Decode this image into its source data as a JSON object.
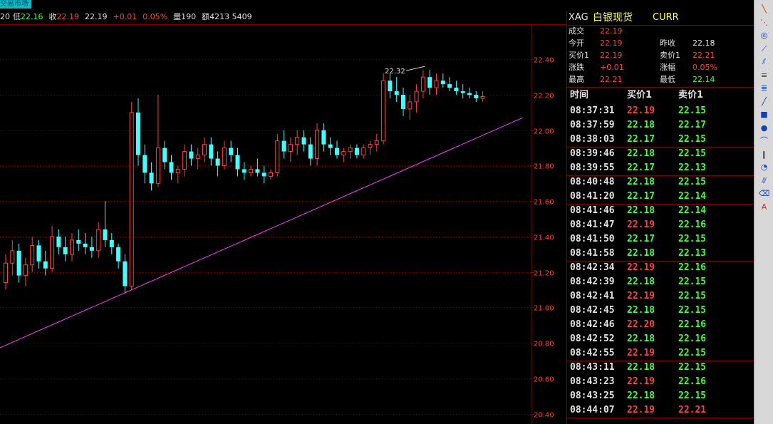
{
  "window": {
    "market_tab": "交易市场"
  },
  "infobar": {
    "items": [
      {
        "label": "20",
        "value": "",
        "color": "white"
      },
      {
        "label": "低",
        "value": "22.16",
        "color": "green"
      },
      {
        "label": "收",
        "value": "22.19",
        "color": "red"
      },
      {
        "label": "",
        "value": "22.19",
        "color": "white"
      },
      {
        "label": "",
        "value": "+0.01",
        "color": "red"
      },
      {
        "label": "",
        "value": "0.05%",
        "color": "red"
      },
      {
        "label": "量",
        "value": "190",
        "color": "white"
      },
      {
        "label": "额",
        "value": "4213 5409",
        "color": "white"
      }
    ]
  },
  "quote": {
    "code": "XAG",
    "name": "白银现货",
    "curr": "CURR",
    "stats": {
      "成交": {
        "label": "成交",
        "value": "22.19"
      },
      "今开": {
        "label": "今开",
        "value": "22.19"
      },
      "昨收": {
        "label": "昨收",
        "value": "22.18"
      },
      "买价1": {
        "label": "买价1",
        "value": "22.19"
      },
      "卖价1": {
        "label": "卖价1",
        "value": "22.21"
      },
      "涨跌": {
        "label": "涨跌",
        "value": "+0.01"
      },
      "涨幅": {
        "label": "涨幅",
        "value": "0.05%"
      },
      "最高": {
        "label": "最高",
        "value": "22.21"
      },
      "最低": {
        "label": "最低",
        "value": "22.14"
      }
    },
    "ticks_header": {
      "time": "时间",
      "bid": "买价1",
      "ask": "卖价1"
    },
    "ticks": [
      {
        "time": "08:37:31",
        "bid": "22.19",
        "ask": "22.15",
        "bid_color": "red"
      },
      {
        "time": "08:37:59",
        "bid": "22.18",
        "ask": "22.17",
        "bid_color": "green"
      },
      {
        "time": "08:38:03",
        "bid": "22.17",
        "ask": "22.15",
        "bid_color": "green"
      },
      {
        "time": "08:39:46",
        "bid": "22.18",
        "ask": "22.15",
        "bid_color": "green"
      },
      {
        "time": "08:39:55",
        "bid": "22.17",
        "ask": "22.13",
        "bid_color": "green"
      },
      {
        "time": "08:40:48",
        "bid": "22.18",
        "ask": "22.15",
        "bid_color": "green"
      },
      {
        "time": "08:41:20",
        "bid": "22.17",
        "ask": "22.14",
        "bid_color": "green"
      },
      {
        "time": "08:41:46",
        "bid": "22.18",
        "ask": "22.14",
        "bid_color": "green"
      },
      {
        "time": "08:41:47",
        "bid": "22.19",
        "ask": "22.16",
        "bid_color": "red"
      },
      {
        "time": "08:41:50",
        "bid": "22.17",
        "ask": "22.15",
        "bid_color": "green"
      },
      {
        "time": "08:41:58",
        "bid": "22.18",
        "ask": "22.13",
        "bid_color": "green"
      },
      {
        "time": "08:42:34",
        "bid": "22.19",
        "ask": "22.16",
        "bid_color": "red"
      },
      {
        "time": "08:42:39",
        "bid": "22.18",
        "ask": "22.15",
        "bid_color": "green"
      },
      {
        "time": "08:42:41",
        "bid": "22.19",
        "ask": "22.15",
        "bid_color": "red"
      },
      {
        "time": "08:42:45",
        "bid": "22.18",
        "ask": "22.15",
        "bid_color": "green"
      },
      {
        "time": "08:42:46",
        "bid": "22.20",
        "ask": "22.16",
        "bid_color": "red"
      },
      {
        "time": "08:42:52",
        "bid": "22.18",
        "ask": "22.16",
        "bid_color": "green"
      },
      {
        "time": "08:42:55",
        "bid": "22.19",
        "ask": "22.15",
        "bid_color": "red"
      },
      {
        "time": "08:43:11",
        "bid": "22.18",
        "ask": "22.15",
        "bid_color": "green"
      },
      {
        "time": "08:43:23",
        "bid": "22.19",
        "ask": "22.16",
        "bid_color": "red"
      },
      {
        "time": "08:43:25",
        "bid": "22.18",
        "ask": "22.15",
        "bid_color": "green"
      },
      {
        "time": "08:44:07",
        "bid": "22.19",
        "ask": "22.21",
        "bid_color": "red"
      }
    ]
  },
  "toolbar": {
    "tools": [
      {
        "name": "line-tool-icon",
        "glyph": "╲"
      },
      {
        "name": "ray-tool-icon",
        "glyph": "⋱"
      },
      {
        "name": "arc-tool-icon",
        "glyph": "◎"
      },
      {
        "name": "fan-tool-icon",
        "glyph": "⟋"
      },
      {
        "name": "channel-tool-icon",
        "glyph": "⫽"
      },
      {
        "name": "fib-tool-icon",
        "glyph": "≡"
      },
      {
        "name": "level-tool-icon",
        "glyph": "≣"
      },
      {
        "name": "trend-tool-icon",
        "glyph": "╱"
      },
      {
        "name": "rectangle-tool-icon",
        "glyph": "■"
      },
      {
        "name": "ellipse-tool-icon",
        "glyph": "●"
      },
      {
        "name": "cycle-tool-icon",
        "glyph": "⌒"
      },
      {
        "name": "vertical-lines-tool-icon",
        "glyph": "‖"
      },
      {
        "name": "spiral-tool-icon",
        "glyph": "◔"
      },
      {
        "name": "parallel-tool-icon",
        "glyph": "⫻"
      },
      {
        "name": "eraser-tool-icon",
        "glyph": "⌫"
      },
      {
        "name": "text-tool-icon",
        "glyph": "A"
      }
    ]
  },
  "chart_data": {
    "type": "candlestick",
    "y_ticks": [
      "22.40",
      "22.20",
      "22.00",
      "21.80",
      "21.60",
      "21.40",
      "21.20",
      "21.00",
      "20.80",
      "20.60",
      "20.40"
    ],
    "ylim": [
      20.35,
      22.55
    ],
    "annotation": {
      "text": "22.32",
      "value": 22.32,
      "index": 57
    },
    "trendline": {
      "start": {
        "index": -1,
        "value": 20.77
      },
      "end": {
        "index": 78,
        "value": 22.07
      }
    },
    "candles": [
      [
        21.14,
        21.3,
        21.1,
        21.25
      ],
      [
        21.25,
        21.38,
        21.18,
        21.32
      ],
      [
        21.32,
        21.36,
        21.14,
        21.18
      ],
      [
        21.18,
        21.28,
        21.12,
        21.24
      ],
      [
        21.24,
        21.4,
        21.2,
        21.35
      ],
      [
        21.35,
        21.38,
        21.22,
        21.26
      ],
      [
        21.26,
        21.32,
        21.18,
        21.22
      ],
      [
        21.22,
        21.46,
        21.2,
        21.4
      ],
      [
        21.4,
        21.44,
        21.3,
        21.34
      ],
      [
        21.34,
        21.4,
        21.26,
        21.3
      ],
      [
        21.3,
        21.42,
        21.26,
        21.38
      ],
      [
        21.38,
        21.44,
        21.32,
        21.36
      ],
      [
        21.36,
        21.42,
        21.3,
        21.34
      ],
      [
        21.34,
        21.4,
        21.28,
        21.32
      ],
      [
        21.32,
        21.48,
        21.28,
        21.44
      ],
      [
        21.44,
        21.6,
        21.34,
        21.38
      ],
      [
        21.38,
        21.42,
        21.3,
        21.34
      ],
      [
        21.34,
        21.36,
        21.22,
        21.26
      ],
      [
        21.26,
        21.3,
        21.08,
        21.12
      ],
      [
        21.12,
        22.16,
        21.1,
        22.1
      ],
      [
        22.1,
        22.18,
        21.8,
        21.86
      ],
      [
        21.86,
        21.92,
        21.7,
        21.76
      ],
      [
        21.76,
        21.82,
        21.66,
        21.7
      ],
      [
        21.7,
        22.2,
        21.68,
        21.9
      ],
      [
        21.9,
        21.94,
        21.78,
        21.82
      ],
      [
        21.82,
        21.86,
        21.72,
        21.76
      ],
      [
        21.76,
        21.8,
        21.7,
        21.78
      ],
      [
        21.78,
        21.92,
        21.74,
        21.88
      ],
      [
        21.88,
        21.92,
        21.8,
        21.84
      ],
      [
        21.84,
        21.9,
        21.78,
        21.86
      ],
      [
        21.86,
        21.96,
        21.82,
        21.92
      ],
      [
        21.92,
        21.96,
        21.8,
        21.84
      ],
      [
        21.84,
        21.88,
        21.74,
        21.8
      ],
      [
        21.8,
        21.94,
        21.78,
        21.9
      ],
      [
        21.9,
        21.94,
        21.82,
        21.86
      ],
      [
        21.86,
        21.9,
        21.74,
        21.78
      ],
      [
        21.78,
        21.82,
        21.72,
        21.76
      ],
      [
        21.76,
        21.8,
        21.74,
        21.78
      ],
      [
        21.78,
        21.84,
        21.74,
        21.76
      ],
      [
        21.76,
        21.8,
        21.7,
        21.74
      ],
      [
        21.74,
        21.78,
        21.72,
        21.76
      ],
      [
        21.76,
        21.98,
        21.74,
        21.94
      ],
      [
        21.94,
        22.0,
        21.84,
        21.88
      ],
      [
        21.88,
        21.96,
        21.82,
        21.92
      ],
      [
        21.92,
        22.0,
        21.86,
        21.96
      ],
      [
        21.96,
        22.0,
        21.88,
        21.92
      ],
      [
        21.92,
        21.96,
        21.8,
        21.84
      ],
      [
        21.84,
        22.04,
        21.8,
        22.0
      ],
      [
        22.0,
        22.04,
        21.88,
        21.92
      ],
      [
        21.92,
        21.96,
        21.86,
        21.9
      ],
      [
        21.9,
        21.94,
        21.84,
        21.86
      ],
      [
        21.86,
        21.9,
        21.82,
        21.88
      ],
      [
        21.88,
        21.92,
        21.84,
        21.9
      ],
      [
        21.9,
        21.92,
        21.84,
        21.86
      ],
      [
        21.86,
        21.92,
        21.84,
        21.9
      ],
      [
        21.9,
        21.94,
        21.86,
        21.92
      ],
      [
        21.92,
        21.98,
        21.88,
        21.94
      ],
      [
        21.94,
        22.32,
        21.92,
        22.28
      ],
      [
        22.28,
        22.32,
        22.18,
        22.22
      ],
      [
        22.22,
        22.3,
        22.16,
        22.2
      ],
      [
        22.2,
        22.24,
        22.08,
        22.12
      ],
      [
        22.12,
        22.2,
        22.06,
        22.16
      ],
      [
        22.16,
        22.26,
        22.1,
        22.22
      ],
      [
        22.22,
        22.34,
        22.18,
        22.3
      ],
      [
        22.3,
        22.34,
        22.2,
        22.24
      ],
      [
        22.24,
        22.32,
        22.2,
        22.28
      ],
      [
        22.28,
        22.32,
        22.24,
        22.26
      ],
      [
        22.26,
        22.3,
        22.22,
        22.24
      ],
      [
        22.24,
        22.28,
        22.2,
        22.22
      ],
      [
        22.22,
        22.26,
        22.18,
        22.21
      ],
      [
        22.21,
        22.24,
        22.18,
        22.2
      ],
      [
        22.2,
        22.22,
        22.16,
        22.18
      ],
      [
        22.18,
        22.22,
        22.16,
        22.19
      ]
    ]
  }
}
